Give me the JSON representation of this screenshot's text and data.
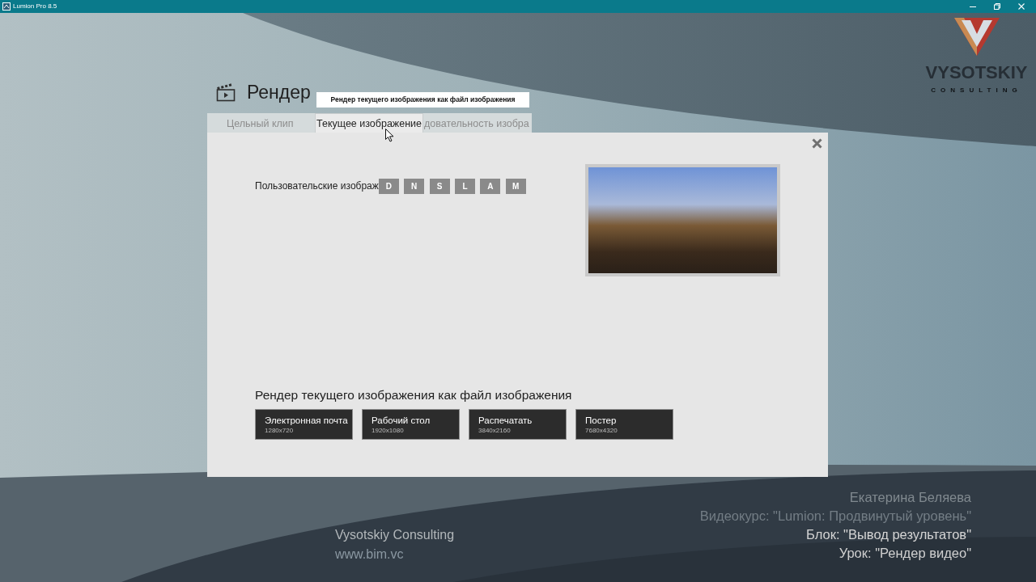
{
  "window": {
    "title": "Lumion Pro 8.5"
  },
  "logo": {
    "name": "VYSOTSKIY",
    "subtitle": "CONSULTING"
  },
  "header": {
    "title": "Рендер",
    "tooltip": "Рендер текущего изображения как файл изображения"
  },
  "tabs": [
    {
      "label": "Цельный клип",
      "selected": false
    },
    {
      "label": "Текущее изображение",
      "selected": true
    },
    {
      "label": "довательность изобра",
      "selected": false
    }
  ],
  "panel": {
    "custom_images": {
      "label": "Пользовательские изображ",
      "buttons": [
        "D",
        "N",
        "S",
        "L",
        "A",
        "M"
      ]
    },
    "section_title": "Рендер текущего изображения как файл изображения",
    "size_buttons": [
      {
        "label": "Электронная почта",
        "resolution": "1280x720"
      },
      {
        "label": "Рабочий стол",
        "resolution": "1920x1080"
      },
      {
        "label": "Распечатать",
        "resolution": "3840x2160"
      },
      {
        "label": "Постер",
        "resolution": "7680x4320"
      }
    ]
  },
  "overlay": {
    "company": "Vysotskiy Consulting",
    "website": "www.bim.vc",
    "credits": [
      {
        "text": "Екатерина Беляева",
        "color": "#80898f"
      },
      {
        "text": "Видеокурс: \"Lumion: Продвинутый уровень\"",
        "color": "#737d85"
      },
      {
        "text": "Блок: \"Вывод результатов\"",
        "color": "#d4d4d4"
      },
      {
        "text": "Урок: \"Рендер видео\"",
        "color": "#d0d0d0"
      }
    ]
  }
}
